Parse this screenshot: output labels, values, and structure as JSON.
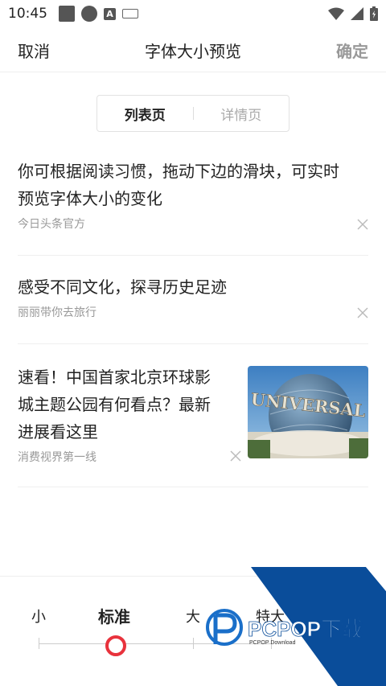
{
  "status_bar": {
    "time": "10:45"
  },
  "header": {
    "cancel": "取消",
    "title": "字体大小预览",
    "confirm": "确定"
  },
  "tabs": {
    "active": "列表页",
    "inactive": "详情页"
  },
  "feed": [
    {
      "title_line1": "你可根据阅读习惯，拖动下边的滑块，可实时",
      "title_line2": "预览字体大小的变化",
      "source": "今日头条官方"
    },
    {
      "title_line1": "感受不同文化，探寻历史足迹",
      "source": "丽丽带你去旅行"
    },
    {
      "title_line1": "速看！中国首家北京环球影",
      "title_line2": "城主题公园有何看点？最新",
      "title_line3": "进展看这里",
      "source": "消费视界第一线",
      "image_text": "UNIVERSAL"
    }
  ],
  "size_options": [
    "小",
    "标准",
    "大",
    "特大"
  ],
  "selected_size": "标准",
  "watermark": {
    "text": "PCPOP下载",
    "subtext": "PCPOP Download"
  },
  "colors": {
    "accent": "#e8323c",
    "watermark_blue": "#0a4d9a"
  }
}
